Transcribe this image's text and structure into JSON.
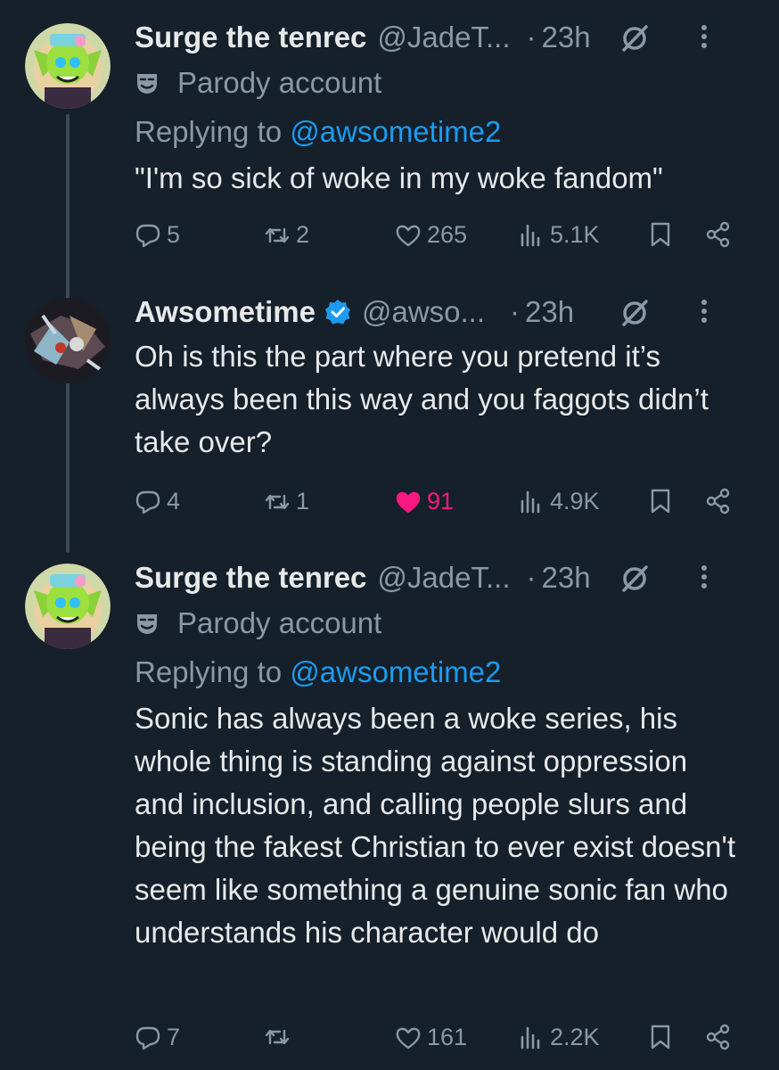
{
  "tweets": [
    {
      "name": "Surge the tenrec",
      "handle": "@JadeT...",
      "dot": "·",
      "time": "23h",
      "verified": false,
      "parody_label": "Parody account",
      "replying_prefix": "Replying to",
      "replying_handle": "@awsometime2",
      "text": "\"I'm so sick of woke in my woke fandom\"",
      "replies": "5",
      "reposts": "2",
      "likes": "265",
      "liked": false,
      "views": "5.1K"
    },
    {
      "name": "Awsometime",
      "handle": "@awso...",
      "dot": "·",
      "time": "23h",
      "verified": true,
      "text": "Oh is this the part where you pretend it’s always been this way and you faggots didn’t take over?",
      "replies": "4",
      "reposts": "1",
      "likes": "91",
      "liked": true,
      "views": "4.9K"
    },
    {
      "name": "Surge the tenrec",
      "handle": "@JadeT...",
      "dot": "·",
      "time": "23h",
      "verified": false,
      "parody_label": "Parody account",
      "replying_prefix": "Replying to",
      "replying_handle": "@awsometime2",
      "text": "Sonic has always been a woke series, his whole thing is standing against oppression and inclusion, and calling people slurs and being the fakest Christian to ever exist doesn't seem like something a genuine sonic fan who understands his character would do",
      "replies": "7",
      "reposts": "",
      "likes": "161",
      "liked": false,
      "views": "2.2K"
    }
  ],
  "colors": {
    "background": "#15202b",
    "text": "#e7e9ea",
    "secondary": "#8b98a5",
    "link": "#1d9bf0",
    "like_active": "#f91880",
    "verified": "#1d9bf0"
  },
  "icons": [
    "reply-icon",
    "repost-icon",
    "heart-icon",
    "views-icon",
    "bookmark-icon",
    "share-icon",
    "grok-icon",
    "more-icon",
    "parody-mask-icon",
    "verified-badge-icon"
  ]
}
